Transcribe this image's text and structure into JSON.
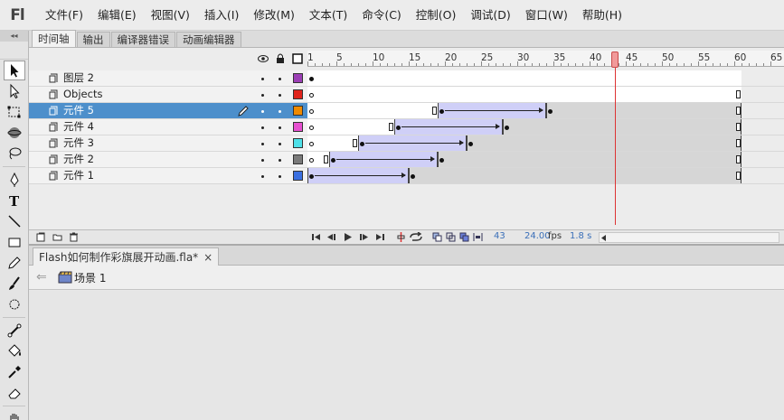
{
  "app": {
    "logo": "Fl"
  },
  "menu": [
    "文件(F)",
    "编辑(E)",
    "视图(V)",
    "插入(I)",
    "修改(M)",
    "文本(T)",
    "命令(C)",
    "控制(O)",
    "调试(D)",
    "窗口(W)",
    "帮助(H)"
  ],
  "panel_tabs": [
    {
      "label": "时间轴",
      "active": true
    },
    {
      "label": "输出",
      "active": false
    },
    {
      "label": "编译器错误",
      "active": false
    },
    {
      "label": "动画编辑器",
      "active": false
    }
  ],
  "ruler_labels": [
    "1",
    "5",
    "10",
    "15",
    "20",
    "25",
    "30",
    "35",
    "40",
    "45",
    "50",
    "55",
    "60",
    "65"
  ],
  "layers": [
    {
      "name": "图层 2",
      "color": "#9b3fb5",
      "selected": false
    },
    {
      "name": "Objects",
      "color": "#e0231b",
      "selected": false
    },
    {
      "name": "元件 5",
      "color": "#f08a00",
      "selected": true
    },
    {
      "name": "元件 4",
      "color": "#e64fd0",
      "selected": false
    },
    {
      "name": "元件 3",
      "color": "#4ee0e8",
      "selected": false
    },
    {
      "name": "元件 2",
      "color": "#7a7a7a",
      "selected": false
    },
    {
      "name": "元件 1",
      "color": "#3a6fe0",
      "selected": false
    }
  ],
  "frames": [
    {
      "total": 60,
      "empty_start": 0,
      "segments": [],
      "keyframe_at": 1,
      "end_box": false
    },
    {
      "total": 60,
      "empty_start": 1,
      "segments": [],
      "end_box": true
    },
    {
      "total": 60,
      "empty_start": 1,
      "empty_end": 19,
      "tween": [
        19,
        33
      ],
      "end_box": true
    },
    {
      "total": 60,
      "empty_start": 1,
      "empty_end": 13,
      "tween": [
        13,
        27
      ],
      "end_box": true
    },
    {
      "total": 60,
      "empty_start": 1,
      "empty_end": 8,
      "tween": [
        8,
        22
      ],
      "end_box": true
    },
    {
      "total": 60,
      "empty_start": 1,
      "empty_end": 4,
      "tween": [
        4,
        18
      ],
      "end_box": true
    },
    {
      "total": 60,
      "empty_start": 0,
      "tween": [
        1,
        14
      ],
      "end_box": true
    }
  ],
  "playhead_frame": 43,
  "footer": {
    "frame": "43",
    "fps": "24.00",
    "fps_unit": "fps",
    "time": "1.8 s"
  },
  "document": {
    "tab_title": "Flash如何制作彩旗展开动画.fla*",
    "close": "×"
  },
  "breadcrumb": {
    "back": "⇐",
    "scene": "场景 1"
  }
}
